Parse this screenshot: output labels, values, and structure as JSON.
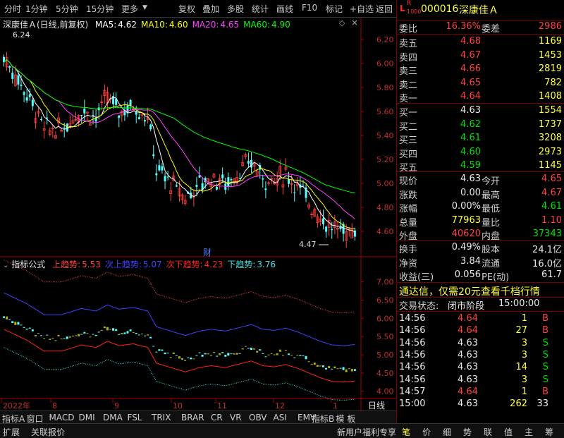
{
  "toolbar": {
    "left_items": [
      "分时",
      "1分钟",
      "5分钟",
      "15分钟",
      "更多"
    ],
    "right_items": [
      "复权",
      "叠加",
      "多股",
      "统计",
      "画线",
      "F10",
      "标记",
      "+自选",
      "返回"
    ]
  },
  "stock": {
    "marker_l": "L",
    "marker_r": "R",
    "marker_sub": "1000",
    "code": "000016",
    "name": "深康佳Ａ"
  },
  "main_chart": {
    "title": "深康佳Ａ(日线,前复权)",
    "ma": [
      {
        "label": "MA5:",
        "value": "4.62",
        "color": "#ffffff"
      },
      {
        "label": "MA10:",
        "value": "4.60",
        "color": "#ffff00"
      },
      {
        "label": "MA20:",
        "value": "4.65",
        "color": "#ff40ff"
      },
      {
        "label": "MA60:",
        "value": "4.90",
        "color": "#00ff00"
      }
    ],
    "high_label": "6.24",
    "low_label": "4.47",
    "cai_label": "财",
    "ylim": [
      4.4,
      6.3
    ],
    "y_ticks": [
      "6.20",
      "6.00",
      "5.80",
      "5.60",
      "5.40",
      "5.20",
      "5.00",
      "4.80",
      "4.60"
    ]
  },
  "indicator": {
    "title": "指标公式",
    "lines": [
      {
        "label": "上趋势:",
        "value": "5.53",
        "color": "#ff4040"
      },
      {
        "label": "次上趋势:",
        "value": "5.07",
        "color": "#4040ff"
      },
      {
        "label": "次下趋势:",
        "value": "4.23",
        "color": "#ff2020"
      },
      {
        "label": "下趋势:",
        "value": "3.76",
        "color": "#40e0e0"
      }
    ],
    "ylim": [
      3.8,
      7.4
    ],
    "y_ticks": [
      "7.00",
      "6.50",
      "6.00",
      "5.50",
      "5.00",
      "4.50",
      "4.00"
    ]
  },
  "x_axis": {
    "labels": [
      "2022年",
      "8",
      "9",
      "10",
      "11",
      "12",
      "1"
    ],
    "right_label": "日线"
  },
  "bottom_tabs": [
    "指标A",
    "窗口",
    "MACD",
    "DMI",
    "DMA",
    "FSL",
    "TRIX",
    "BRAR",
    "CR",
    "VR",
    "OBV",
    "ASI",
    "EMV",
    "指标B",
    "模 板"
  ],
  "quote": {
    "webi_label": "委比",
    "webi_value": "16.36%",
    "wecha_label": "委差",
    "wecha_value": "2986",
    "sells": [
      {
        "label": "卖五",
        "price": "4.68",
        "vol": "1169"
      },
      {
        "label": "卖四",
        "price": "4.67",
        "vol": "1453"
      },
      {
        "label": "卖三",
        "price": "4.66",
        "vol": "2819"
      },
      {
        "label": "卖二",
        "price": "4.65",
        "vol": "782"
      },
      {
        "label": "卖一",
        "price": "4.64",
        "vol": "1408"
      }
    ],
    "buys": [
      {
        "label": "买一",
        "price": "4.63",
        "vol": "1554"
      },
      {
        "label": "买二",
        "price": "4.62",
        "vol": "1737"
      },
      {
        "label": "买三",
        "price": "4.61",
        "vol": "3208"
      },
      {
        "label": "买四",
        "price": "4.60",
        "vol": "2973"
      },
      {
        "label": "买五",
        "price": "4.59",
        "vol": "1145"
      }
    ],
    "stats": [
      {
        "l1": "现价",
        "v1": "4.63",
        "c1": "wht",
        "l2": "今开",
        "v2": "4.65",
        "c2": "red"
      },
      {
        "l1": "涨跌",
        "v1": "0.00",
        "c1": "wht",
        "l2": "最高",
        "v2": "4.67",
        "c2": "red"
      },
      {
        "l1": "涨幅",
        "v1": "0.00%",
        "c1": "wht",
        "l2": "最低",
        "v2": "4.61",
        "c2": "grn"
      },
      {
        "l1": "总量",
        "v1": "77963",
        "c1": "yel",
        "l2": "量比",
        "v2": "1.10",
        "c2": "red"
      },
      {
        "l1": "外盘",
        "v1": "40620",
        "c1": "red",
        "l2": "内盘",
        "v2": "37343",
        "c2": "grn"
      }
    ],
    "stats2": [
      {
        "l1": "换手",
        "v1": "0.49%",
        "l2": "股本",
        "v2": "24.1亿"
      },
      {
        "l1": "净资",
        "v1": "3.84",
        "l2": "流通",
        "v2": "16.0亿"
      },
      {
        "l1": "收益(三)",
        "v1": "0.056",
        "l2": "PE(动)",
        "v2": "61.7"
      }
    ],
    "ad_text": "通达信，仅需20元查看千档行情",
    "trade_status_label": "交易状态:",
    "trade_status_value": "闭市阶段",
    "trade_status_time": "15:00:00",
    "ticks": [
      {
        "time": "14:56",
        "price": "4.64",
        "pc": "red",
        "vol": "1",
        "flag": "B"
      },
      {
        "time": "14:56",
        "price": "4.64",
        "pc": "red",
        "vol": "27",
        "flag": "B"
      },
      {
        "time": "14:56",
        "price": "4.63",
        "pc": "wht",
        "vol": "3",
        "flag": "S"
      },
      {
        "time": "14:56",
        "price": "4.63",
        "pc": "wht",
        "vol": "3",
        "flag": "S"
      },
      {
        "time": "14:56",
        "price": "4.63",
        "pc": "wht",
        "vol": "14",
        "flag": "S"
      },
      {
        "time": "14:56",
        "price": "4.63",
        "pc": "wht",
        "vol": "3",
        "flag": "S"
      },
      {
        "time": "14:57",
        "price": "4.64",
        "pc": "red",
        "vol": "1",
        "flag": "B"
      },
      {
        "time": "15:00",
        "price": "4.63",
        "pc": "wht",
        "vol": "262",
        "flag": "33"
      }
    ]
  },
  "status_bar": {
    "left": [
      "扩展",
      "关联报价"
    ],
    "promo": "新用户福利专享",
    "tabs": [
      "笔",
      "价",
      "细",
      "势",
      "联",
      "值",
      "主",
      "筹"
    ]
  }
}
